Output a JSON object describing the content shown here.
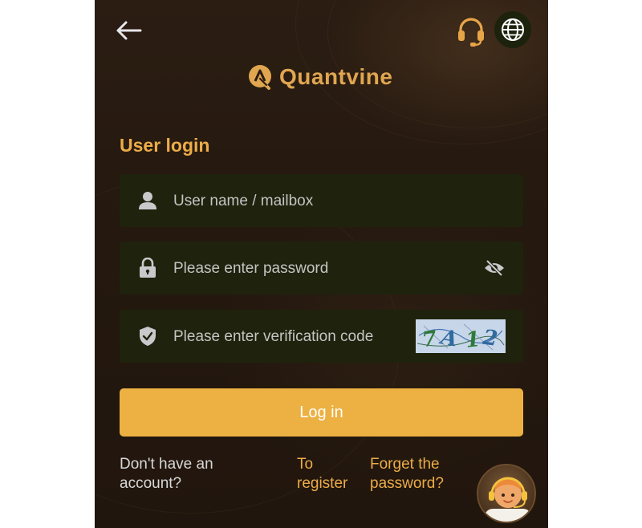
{
  "brand": {
    "name": "Quantvine"
  },
  "header": {
    "back_icon": "arrow-left-icon",
    "support_icon": "headset-icon",
    "language_icon": "globe-icon"
  },
  "form": {
    "title": "User login",
    "username_placeholder": "User name / mailbox",
    "password_placeholder": "Please enter password",
    "verification_placeholder": "Please enter verification code",
    "captcha_text": "7A12",
    "login_label": "Log in"
  },
  "footer": {
    "no_account_line1": "Don't have an",
    "no_account_line2": "account?",
    "register_line1": "To",
    "register_line2": "register",
    "forgot_line1": "Forget the",
    "forgot_line2": "password?"
  },
  "colors": {
    "accent": "#ecb142",
    "title": "#ecac48",
    "background": "#24180f",
    "field_bg": "#1f220c"
  }
}
